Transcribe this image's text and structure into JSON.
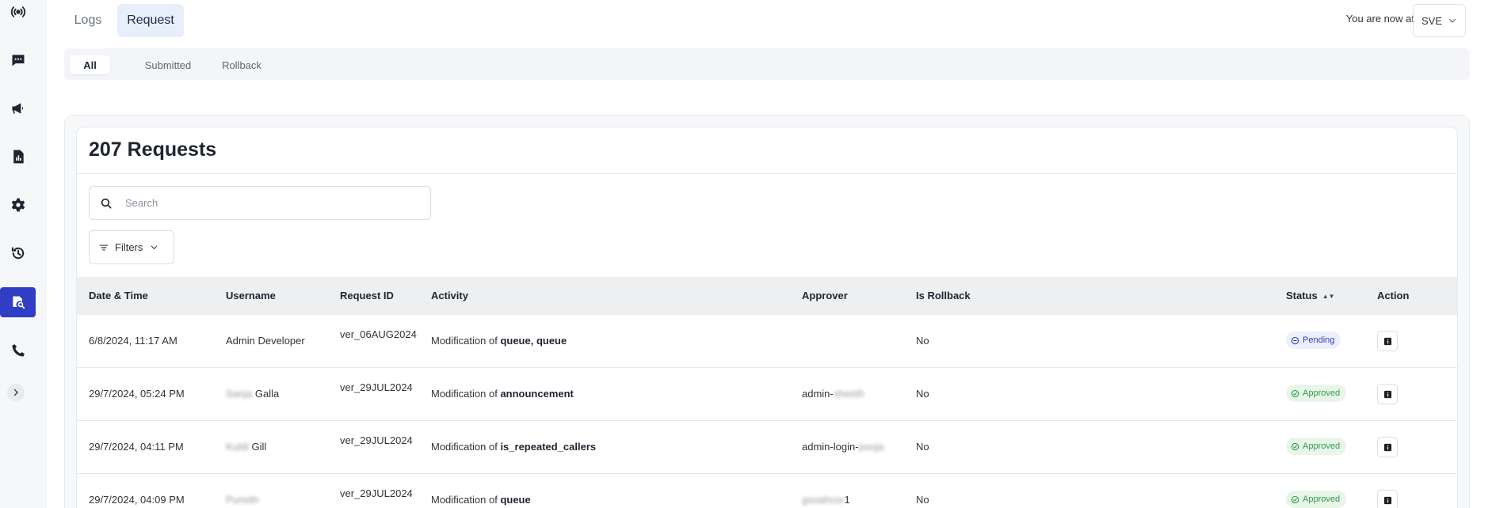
{
  "tabs": {
    "logs": "Logs",
    "request": "Request"
  },
  "location": {
    "label": "You are now at",
    "value": "SVE"
  },
  "subtabs": {
    "all": "All",
    "submitted": "Submitted",
    "rollback": "Rollback"
  },
  "card": {
    "title": "207 Requests"
  },
  "search": {
    "placeholder": "Search"
  },
  "filters": {
    "label": "Filters"
  },
  "table": {
    "headers": {
      "datetime": "Date & Time",
      "username": "Username",
      "request_id": "Request ID",
      "activity": "Activity",
      "approver": "Approver",
      "is_rollback": "Is Rollback",
      "status": "Status",
      "action": "Action"
    },
    "rows": [
      {
        "datetime": "6/8/2024, 11:17 AM",
        "username": "Admin Developer",
        "request_id": "ver_06AUG2024",
        "activity_prefix": "Modification of ",
        "activity_target": "queue, queue",
        "approver": "",
        "is_rollback": "No",
        "status": "Pending"
      },
      {
        "datetime": "29/7/2024, 05:24 PM",
        "username_blur": "Sanja",
        "username": "Galla",
        "request_id": "ver_29JUL2024",
        "activity_prefix": "Modification of ",
        "activity_target": "announcement",
        "approver": "admin-",
        "approver_blur": "sheeth",
        "is_rollback": "No",
        "status": "Approved"
      },
      {
        "datetime": "29/7/2024, 04:11 PM",
        "username_blur": "Kuldi",
        "username": "Gill",
        "request_id": "ver_29JUL2024",
        "activity_prefix": "Modification of ",
        "activity_target": "is_repeated_callers",
        "approver": "admin-login-",
        "approver_blur": "pooja",
        "is_rollback": "No",
        "status": "Approved"
      },
      {
        "datetime": "29/7/2024, 04:09 PM",
        "username_blur": "Puneth",
        "username": "",
        "request_id": "ver_29JUL2024",
        "activity_prefix": "Modification of ",
        "activity_target": "queue",
        "approver": "1",
        "approver_blur": "gsoahcor",
        "is_rollback": "No",
        "status": "Approved"
      }
    ]
  },
  "colors": {
    "accent": "#2f3ec4",
    "approved": "#2f9c45",
    "pending": "#2f3ec4"
  },
  "icons": {
    "sidebar": [
      "broadcast-icon",
      "chat-icon",
      "megaphone-icon",
      "report-icon",
      "gear-icon",
      "history-icon",
      "audit-search-icon",
      "phone-icon"
    ]
  }
}
